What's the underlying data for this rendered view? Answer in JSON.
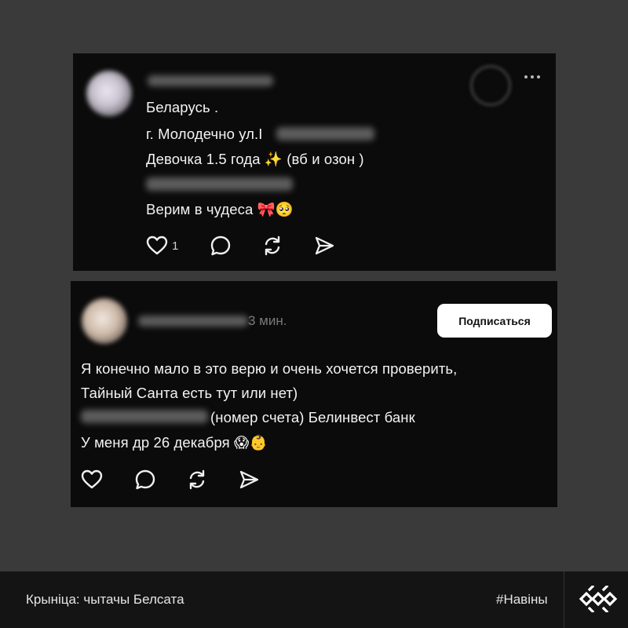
{
  "post1": {
    "lines": [
      "Беларусь .",
      "г. Молодечно ул.I",
      "Девочка 1.5 года",
      "(вб и озон )",
      "Верим в чудеса"
    ],
    "emoji": {
      "sparkles": "✨",
      "bow": "🎀",
      "pleading": "🥺"
    },
    "like_count": "1"
  },
  "post2": {
    "time": "3 мин.",
    "follow_label": "Подписаться",
    "lines": [
      "Я конечно мало в это верю и очень хочется проверить,",
      "Тайный Санта есть тут или нет)",
      "(номер счета) Белинвест банк",
      "У меня др 26 декабря"
    ],
    "emoji": {
      "shocked": "😱",
      "baby": "👶"
    }
  },
  "footer": {
    "source": "Крыніца: чытачы Белсата",
    "hashtag": "#Навіны"
  },
  "icons": {
    "like": "heart-icon",
    "comment": "comment-icon",
    "repost": "repost-icon",
    "share": "share-icon",
    "more": "more-icon",
    "logo": "belsat-logo"
  },
  "colors": {
    "background": "#3a3a3a",
    "card": "#0b0b0b",
    "footer": "#141414",
    "button": "#ffffff",
    "text": "#f3f3f3"
  }
}
